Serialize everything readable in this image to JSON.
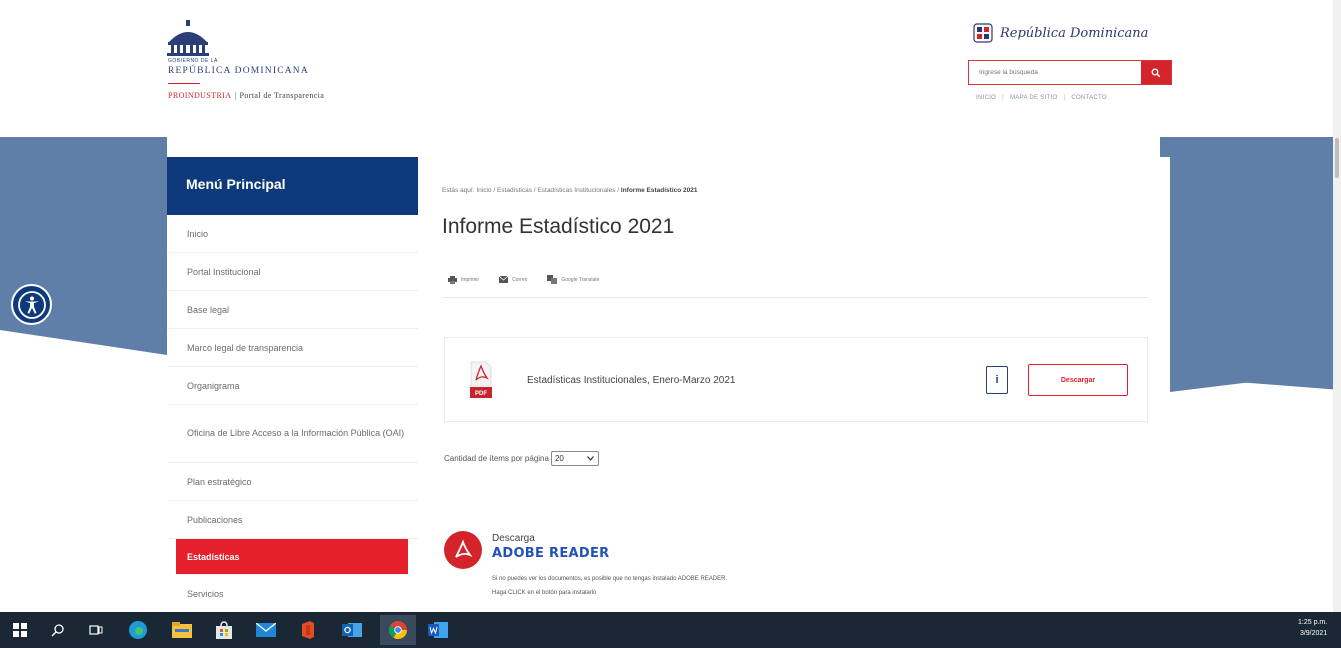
{
  "header": {
    "gov_small": "GOBIERNO DE LA",
    "gov_big": "REPÚBLICA DOMINICANA",
    "institution": "PROINDUSTRIA",
    "portal": "Portal de Transparencia",
    "brand": "República Dominicana",
    "search_placeholder": "Ingrese la búsqueda",
    "links": [
      "INICIO",
      "MAPA DE SITIO",
      "CONTACTO"
    ]
  },
  "sidebar": {
    "title": "Menú Principal",
    "items": [
      "Inicio",
      "Portal Institucional",
      "Base legal",
      "Marco legal de transparencia",
      "Organigrama",
      "Oficina de Libre Acceso a la Información Pública (OAI)",
      "Plan estratégico",
      "Publicaciones",
      "Estadísticas",
      "Servicios"
    ],
    "active_index": 8
  },
  "content": {
    "breadcrumb_prefix": "Estás aquí:",
    "breadcrumb": [
      "Inicio",
      "Estadísticas",
      "Estadísticas Institucionales"
    ],
    "breadcrumb_current": "Informe Estadístico 2021",
    "title": "Informe Estadístico 2021",
    "toolbar": [
      "Imprimir",
      "Correo",
      "Google Translate"
    ],
    "document": {
      "title": "Estadísticas Institucionales, Enero-Marzo 2021",
      "pdf_label": "PDF",
      "info_label": "i",
      "download_label": "Descargar"
    },
    "per_page_label": "Cantidad de ítems por página",
    "per_page_value": "20",
    "adobe": {
      "sub": "Descarga",
      "big": "ADOBE READER",
      "line1": "Si no puedes ver los documentos, es posible que no tengas instalado ADOBE READER.",
      "line2": "Haga CLICK en el botón para instalarlo"
    }
  },
  "taskbar": {
    "time": "1:25 p.m.",
    "date": "3/9/2021"
  },
  "colors": {
    "navy": "#0e3a7b",
    "red": "#e5202c",
    "band": "#5f7fa8"
  }
}
